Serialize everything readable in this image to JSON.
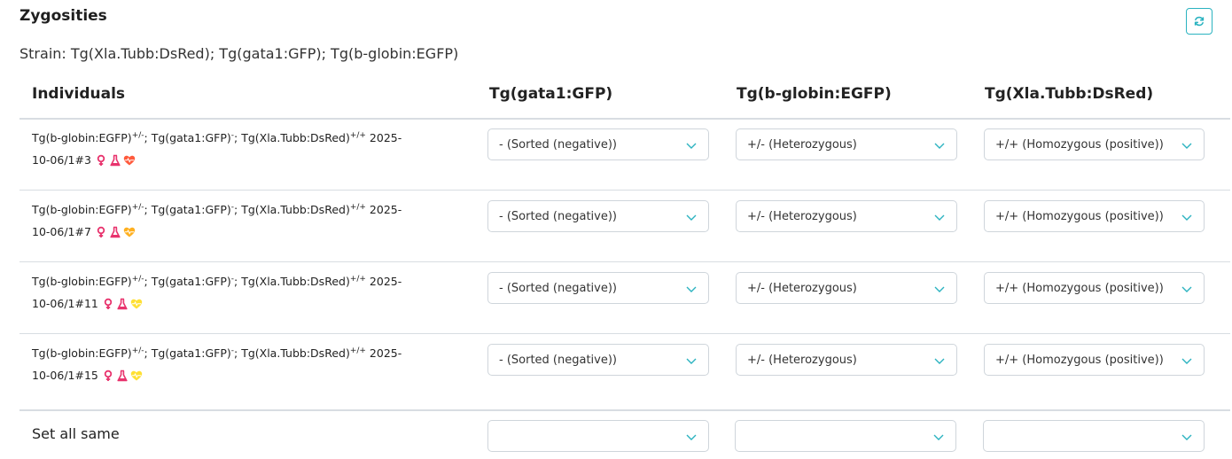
{
  "title": "Zygosities",
  "strain": "Strain: Tg(Xla.Tubb:DsRed); Tg(gata1:GFP); Tg(b-globin:EGFP)",
  "refresh_icon": "refresh-icon",
  "headers": {
    "individuals": "Individuals",
    "col1": "Tg(gata1:GFP)",
    "col2": "Tg(b-globin:EGFP)",
    "col3": "Tg(Xla.Tubb:DsRed)"
  },
  "genotype": {
    "g1": "Tg(b-globin:EGFP)",
    "g1_sup": "+/-",
    "g2": "; Tg(gata1:GFP)",
    "g2_sup": "-",
    "g3": "; Tg(Xla.Tubb:DsRed)",
    "g3_sup": "+/+",
    "date": " 2025-"
  },
  "rows": [
    {
      "id": "10-06/1#3",
      "sel1": "- (Sorted (negative))",
      "sel2": "+/- (Heterozygous)",
      "sel3": "+/+ (Homozygous (positive))",
      "heart_color": "#ff5a3c"
    },
    {
      "id": "10-06/1#7",
      "sel1": "- (Sorted (negative))",
      "sel2": "+/- (Heterozygous)",
      "sel3": "+/+ (Homozygous (positive))",
      "heart_color": "#ffb020"
    },
    {
      "id": "10-06/1#11",
      "sel1": "- (Sorted (negative))",
      "sel2": "+/- (Heterozygous)",
      "sel3": "+/+ (Homozygous (positive))",
      "heart_color": "#ffe033"
    },
    {
      "id": "10-06/1#15",
      "sel1": "- (Sorted (negative))",
      "sel2": "+/- (Heterozygous)",
      "sel3": "+/+ (Homozygous (positive))",
      "heart_color": "#ffe033"
    }
  ],
  "set_all_label": "Set all same",
  "set_all_values": [
    "",
    "",
    ""
  ],
  "colors": {
    "accent": "#2bb3c0",
    "female": "#e8336d",
    "flask": "#e8336d"
  },
  "icons": {
    "female": "female-icon",
    "flask": "flask-icon",
    "heart": "heart-pulse-icon",
    "chevron": "chevron-down-icon"
  }
}
